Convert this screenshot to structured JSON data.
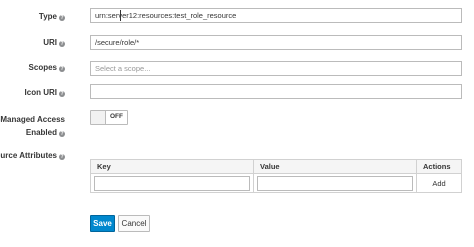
{
  "form": {
    "type": {
      "label": "Type",
      "value": "urn:server12:resources:test_role_resource"
    },
    "uri": {
      "label": "URI",
      "value": "/secure/role/*"
    },
    "scopes": {
      "label": "Scopes",
      "placeholder": "Select a scope..."
    },
    "icon_uri": {
      "label": "Icon URI",
      "value": ""
    },
    "user_managed": {
      "label_line1": "r-Managed Access",
      "label_line2": "Enabled",
      "toggle_text": "OFF",
      "enabled": false
    },
    "attributes": {
      "label": "source Attributes",
      "columns": [
        "Key",
        "Value",
        "Actions"
      ],
      "add_label": "Add"
    }
  },
  "buttons": {
    "save": "Save",
    "cancel": "Cancel"
  },
  "colors": {
    "primary": "#0088ce",
    "help_icon": "#8b8d8f",
    "border": "#bbbbbb"
  }
}
